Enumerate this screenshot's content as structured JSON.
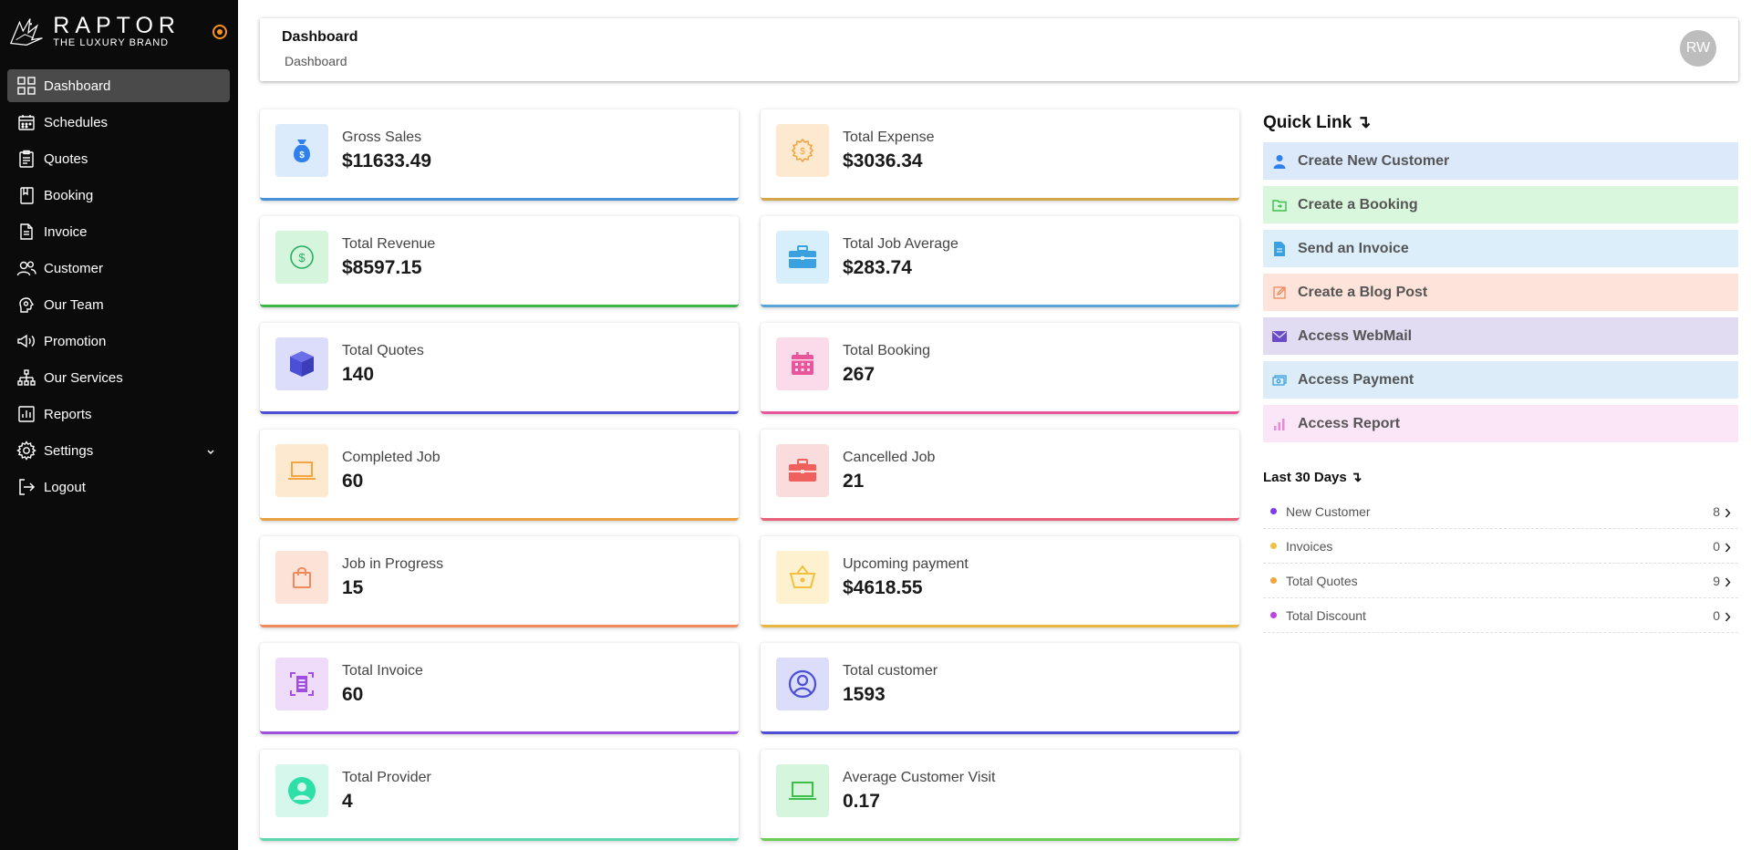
{
  "brand": {
    "name": "RAPTOR",
    "tagline": "THE LUXURY BRAND"
  },
  "sidebar": {
    "items": [
      {
        "label": "Dashboard",
        "icon": "grid-icon"
      },
      {
        "label": "Schedules",
        "icon": "calendar-icon"
      },
      {
        "label": "Quotes",
        "icon": "clipboard-icon"
      },
      {
        "label": "Booking",
        "icon": "bookmark-icon"
      },
      {
        "label": "Invoice",
        "icon": "document-icon"
      },
      {
        "label": "Customer",
        "icon": "users-icon"
      },
      {
        "label": "Our Team",
        "icon": "brain-icon"
      },
      {
        "label": "Promotion",
        "icon": "megaphone-icon"
      },
      {
        "label": "Our Services",
        "icon": "network-icon"
      },
      {
        "label": "Reports",
        "icon": "report-icon"
      },
      {
        "label": "Settings",
        "icon": "gear-icon"
      },
      {
        "label": "Logout",
        "icon": "logout-icon"
      }
    ]
  },
  "header": {
    "title": "Dashboard",
    "breadcrumb": "Dashboard",
    "avatar_initials": "RW"
  },
  "cards": [
    {
      "label": "Gross Sales",
      "value": "$11633.49",
      "icon": "money-bag-icon",
      "color": "#2f80ed",
      "bg": "#dcebfb",
      "border": "#4a90d9"
    },
    {
      "label": "Total Expense",
      "value": "$3036.34",
      "icon": "gear-dollar-icon",
      "color": "#f2a541",
      "bg": "#fde9cf",
      "border": "#d4a64a"
    },
    {
      "label": "Total Revenue",
      "value": "$8597.15",
      "icon": "dollar-circle-icon",
      "color": "#27ae60",
      "bg": "#d6f5dd",
      "border": "#3db549"
    },
    {
      "label": "Total Job Average",
      "value": "$283.74",
      "icon": "briefcase-icon",
      "color": "#3aa0e0",
      "bg": "#d7eefb",
      "border": "#5aa3d6"
    },
    {
      "label": "Total Quotes",
      "value": "140",
      "icon": "cube-icon",
      "color": "#4b4fd6",
      "bg": "#dcdcfb",
      "border": "#4b4fd6"
    },
    {
      "label": "Total Booking",
      "value": "267",
      "icon": "calendar-icon",
      "color": "#e8559a",
      "bg": "#fbdbea",
      "border": "#e8559a"
    },
    {
      "label": "Completed Job",
      "value": "60",
      "icon": "laptop-icon",
      "color": "#f2a541",
      "bg": "#fde9cf",
      "border": "#e8a040"
    },
    {
      "label": "Cancelled Job",
      "value": "21",
      "icon": "briefcase-icon",
      "color": "#f0605d",
      "bg": "#fbdcdc",
      "border": "#e8607a"
    },
    {
      "label": "Job in Progress",
      "value": "15",
      "icon": "shopping-bag-icon",
      "color": "#f08a5d",
      "bg": "#fde2d8",
      "border": "#f08a5d"
    },
    {
      "label": "Upcoming payment",
      "value": "$4618.55",
      "icon": "basket-icon",
      "color": "#f2c041",
      "bg": "#fdf1cf",
      "border": "#e8b840"
    },
    {
      "label": "Total Invoice",
      "value": "60",
      "icon": "scan-document-icon",
      "color": "#a050e0",
      "bg": "#efdcfb",
      "border": "#a050e0"
    },
    {
      "label": "Total customer",
      "value": "1593",
      "icon": "user-circle-icon",
      "color": "#4b4fd6",
      "bg": "#dcdcfb",
      "border": "#4b4fd6"
    },
    {
      "label": "Total Provider",
      "value": "4",
      "icon": "user-avatar-icon",
      "color": "#2ee0a8",
      "bg": "#d6f7ec",
      "border": "#5ed6b0"
    },
    {
      "label": "Average Customer Visit",
      "value": "0.17",
      "icon": "laptop-icon",
      "color": "#3cc04a",
      "bg": "#d6f5dd",
      "border": "#6ccc55"
    }
  ],
  "quick_links": {
    "title": "Quick Link ↴",
    "items": [
      {
        "label": "Create New Customer",
        "icon": "user-icon",
        "bg": "#dce9fb",
        "color": "#2f80ed"
      },
      {
        "label": "Create a Booking",
        "icon": "folder-icon",
        "bg": "#d9f7dc",
        "color": "#3cc04a"
      },
      {
        "label": "Send an Invoice",
        "icon": "file-icon",
        "bg": "#dbeefa",
        "color": "#3aa0e0"
      },
      {
        "label": "Create a Blog Post",
        "icon": "edit-icon",
        "bg": "#fde3d9",
        "color": "#f08a5d"
      },
      {
        "label": "Access WebMail",
        "icon": "mail-icon",
        "bg": "#e2dcf2",
        "color": "#6a4bc8"
      },
      {
        "label": "Access Payment",
        "icon": "cash-icon",
        "bg": "#dcedf9",
        "color": "#3aa0e0"
      },
      {
        "label": "Access Report",
        "icon": "bar-chart-icon",
        "bg": "#fbe6f7",
        "color": "#e88ad8"
      }
    ]
  },
  "last_30": {
    "title": "Last 30 Days ↴",
    "rows": [
      {
        "label": "New Customer",
        "count": "8",
        "dot": "#7c3aed"
      },
      {
        "label": "Invoices",
        "count": "0",
        "dot": "#f2c041"
      },
      {
        "label": "Total Quotes",
        "count": "9",
        "dot": "#f2a541"
      },
      {
        "label": "Total Discount",
        "count": "0",
        "dot": "#c040e0"
      }
    ]
  }
}
